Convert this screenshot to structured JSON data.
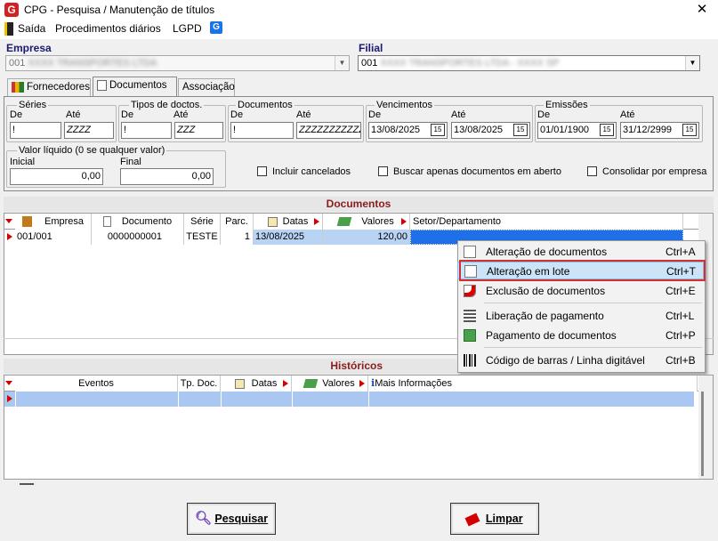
{
  "window": {
    "title": "CPG - Pesquisa / Manutenção de títulos",
    "close_glyph": "✕"
  },
  "menu": {
    "exit": "Saída",
    "daily": "Procedimentos diários",
    "lgpd": "LGPD"
  },
  "empresa": {
    "label": "Empresa",
    "code": "001",
    "name_blurred": "XXXX TRANSPORTES LTDA"
  },
  "filial": {
    "label": "Filial",
    "code": "001",
    "name_blurred": "XXXX TRANSPORTES LTDA - XXXX SP"
  },
  "tabs": [
    "Fornecedores",
    "Documentos",
    "Associação"
  ],
  "filters": {
    "series": {
      "title": "Séries",
      "de_label": "De",
      "ate_label": "Até",
      "de": "!",
      "ate": "ZZZZ"
    },
    "tipos": {
      "title": "Tipos de doctos.",
      "de_label": "De",
      "ate_label": "Até",
      "de": "!",
      "ate": "ZZZ"
    },
    "documentos": {
      "title": "Documentos",
      "de_label": "De",
      "ate_label": "Até",
      "de": "!",
      "ate": "ZZZZZZZZZZZZ"
    },
    "vencimentos": {
      "title": "Vencimentos",
      "de_label": "De",
      "ate_label": "Até",
      "de": "13/08/2025",
      "ate": "13/08/2025"
    },
    "emissoes": {
      "title": "Emissões",
      "de_label": "De",
      "ate_label": "Até",
      "de": "01/01/1900",
      "ate": "31/12/2999"
    },
    "valor": {
      "title": "Valor líquido (0 se qualquer valor)",
      "inicial_label": "Inicial",
      "final_label": "Final",
      "inicial": "0,00",
      "final": "0,00"
    },
    "checks": {
      "cancelados": "Incluir cancelados",
      "abertos": "Buscar apenas documentos em aberto",
      "consolidar": "Consolidar por empresa"
    },
    "cal_glyph": "15"
  },
  "documentos_grid": {
    "title": "Documentos",
    "columns": [
      "Empresa",
      "Documento",
      "Série",
      "Parc.",
      "Datas",
      "Valores",
      "Setor/Departamento"
    ],
    "rows": [
      {
        "empresa": "001/001",
        "documento": "0000000001",
        "serie": "TESTE",
        "parc": "1",
        "data": "13/08/2025",
        "valor": "120,00",
        "setor": ""
      }
    ]
  },
  "context_menu": {
    "items": [
      {
        "label": "Alteração de documentos",
        "shortcut": "Ctrl+A",
        "icon": "edit-doc-icon"
      },
      {
        "label": "Alteração em lote",
        "shortcut": "Ctrl+T",
        "icon": "edit-batch-icon",
        "highlighted": true
      },
      {
        "label": "Exclusão de documentos",
        "shortcut": "Ctrl+E",
        "icon": "delete-doc-icon"
      },
      {
        "label": "Liberação de pagamento",
        "shortcut": "Ctrl+L",
        "icon": "release-payment-icon"
      },
      {
        "label": "Pagamento de documentos",
        "shortcut": "Ctrl+P",
        "icon": "payment-icon"
      },
      {
        "label": "Código de barras / Linha digitável",
        "shortcut": "Ctrl+B",
        "icon": "barcode-icon"
      }
    ]
  },
  "historicos_grid": {
    "title": "Históricos",
    "columns": [
      "Eventos",
      "Tp. Doc.",
      "Datas",
      "Valores",
      "Mais Informações"
    ]
  },
  "buttons": {
    "pesquisar": "Pesquisar",
    "limpar": "Limpar"
  },
  "colors": {
    "accent_red": "#d40000",
    "selection_blue": "#1e6fe8",
    "highlight_box": "#d32f2f",
    "header_text": "#8b1c1c"
  }
}
